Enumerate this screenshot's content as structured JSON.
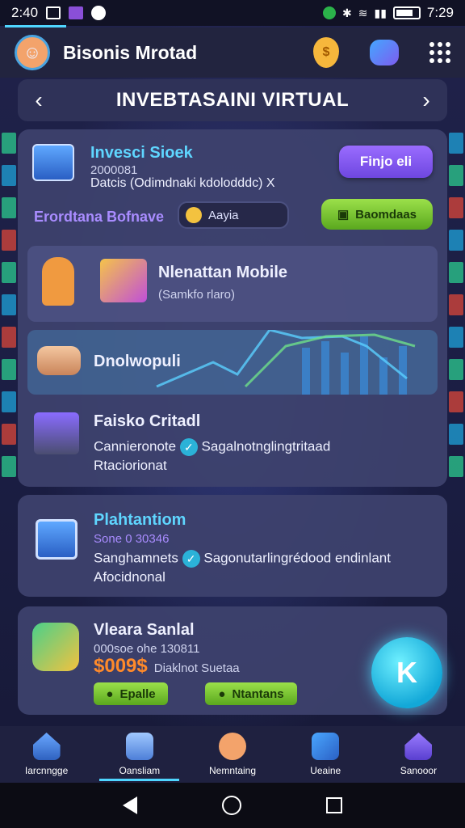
{
  "status_bar": {
    "time_left": "2:40",
    "time_right": "7:29"
  },
  "header": {
    "app_title": "Bisonis Mrotad",
    "avatar_icon": "avatar-icon",
    "coin_icon": "coin-icon",
    "magic_icon": "magic-icon",
    "menu_icon": "grid-menu-icon"
  },
  "titlebar": {
    "title": "INVEBTASAINI VIRTUAL",
    "back_icon": "chevron-left-icon",
    "next_icon": "chevron-right-icon"
  },
  "invest_card": {
    "title": "Invesci Sioek",
    "code": "2000081",
    "description": "Datcis (Odimdnaki kdolodddc)  X",
    "primary_button": "Finjo eli",
    "balance_label": "Erordtana Bofnave",
    "search_value": "Aayia",
    "green_button": "Baomdaas"
  },
  "panel_mobile": {
    "title": "Nlenattan Mobile",
    "subtitle": "(Samkfo rlaro)"
  },
  "panel_chart": {
    "title": "Dnolwopuli"
  },
  "panel_faisko": {
    "title": "Faisko Critadl",
    "line1_left": "Cannieronote",
    "line1_right": "Sagalnotnglingtritaad",
    "line2": "Rtaciorionat"
  },
  "card_platform": {
    "title": "Plahtantiom",
    "code": "Sone 0 30346",
    "line1_left": "Sanghamnets",
    "line1_right": "Sagonutarlingrédood endinlant",
    "line2": "Afocidnonal"
  },
  "card_vleara": {
    "title": "Vleara Sanlal",
    "code": "000soe ohe 130811",
    "amount": "$009$",
    "amount_note": "Diaklnot Suetaa",
    "button_left": "Epalle",
    "button_right": "Ntantans"
  },
  "fab": {
    "label": "K"
  },
  "bottom_nav": [
    {
      "label": "Iarcnngge",
      "icon": "house-icon"
    },
    {
      "label": "Oansliam",
      "icon": "robot-icon"
    },
    {
      "label": "Nemntaing",
      "icon": "person-icon"
    },
    {
      "label": "Ueaine",
      "icon": "gift-icon"
    },
    {
      "label": "Sanooor",
      "icon": "home-sparkle-icon"
    }
  ]
}
